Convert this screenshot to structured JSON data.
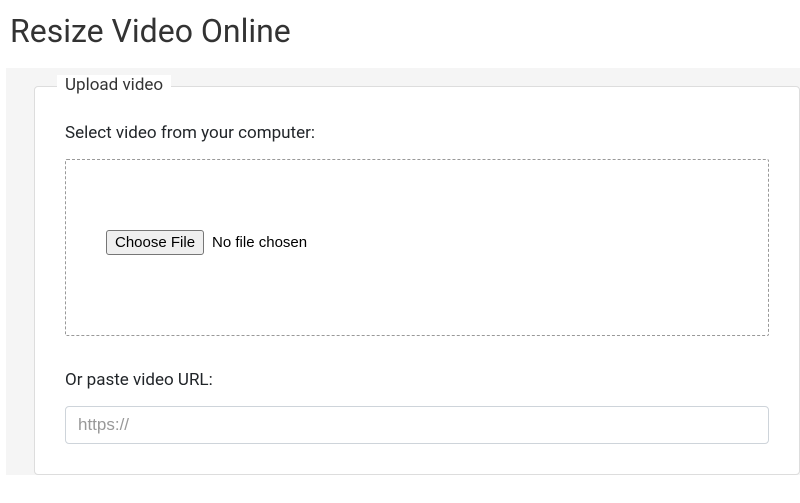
{
  "page": {
    "title": "Resize Video Online"
  },
  "upload": {
    "legend": "Upload video",
    "select_label": "Select video from your computer:",
    "choose_file_button": "Choose File",
    "file_status": "No file chosen",
    "url_label": "Or paste video URL:",
    "url_placeholder": "https://",
    "url_value": ""
  }
}
